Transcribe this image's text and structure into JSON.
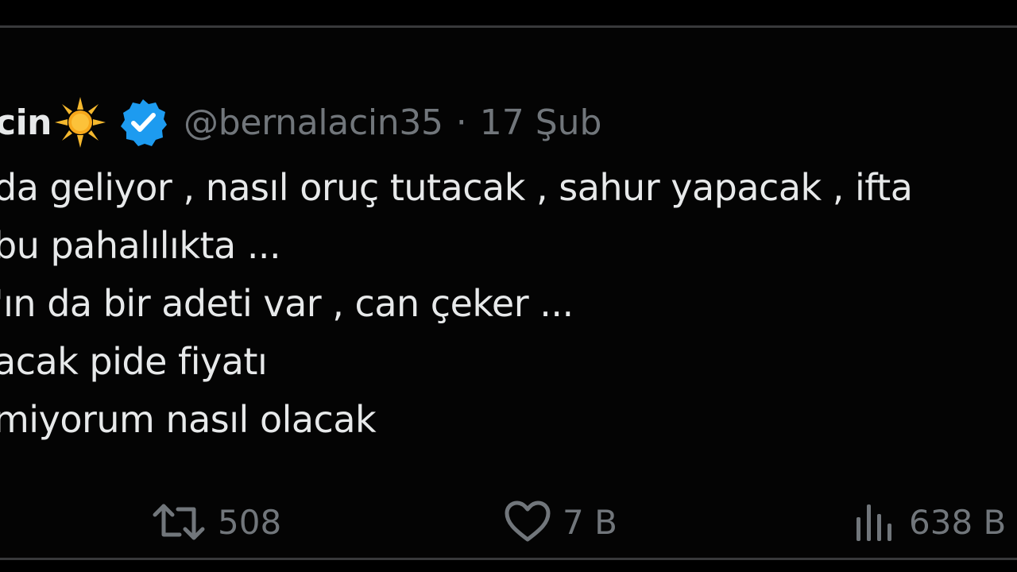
{
  "tweet": {
    "author": {
      "display_name_visible": "cin",
      "name_emoji_icon": "sun-icon",
      "verified_icon": "verified-badge-icon",
      "handle": "@bernalacin35",
      "separator": "·",
      "date": "17 Şub"
    },
    "body_lines": [
      "da geliyor , nasıl oruç tutacak , sahur yapacak , ifta",
      "bu pahalılıkta ...",
      "'ın da bir adeti var , can çeker ...",
      "acak pide fiyatı",
      "miyorum nasıl olacak"
    ],
    "actions": {
      "retweet": {
        "icon": "retweet-icon",
        "count": "508"
      },
      "like": {
        "icon": "heart-icon",
        "count": "7 B"
      },
      "views": {
        "icon": "views-chart-icon",
        "count": "638 B"
      }
    }
  },
  "colors": {
    "background": "#040404",
    "text_primary": "#e7e9ea",
    "text_secondary": "#71767b",
    "verified_blue": "#1d9bf0",
    "sun_yellow": "#f5b82e",
    "border": "#38393b"
  }
}
